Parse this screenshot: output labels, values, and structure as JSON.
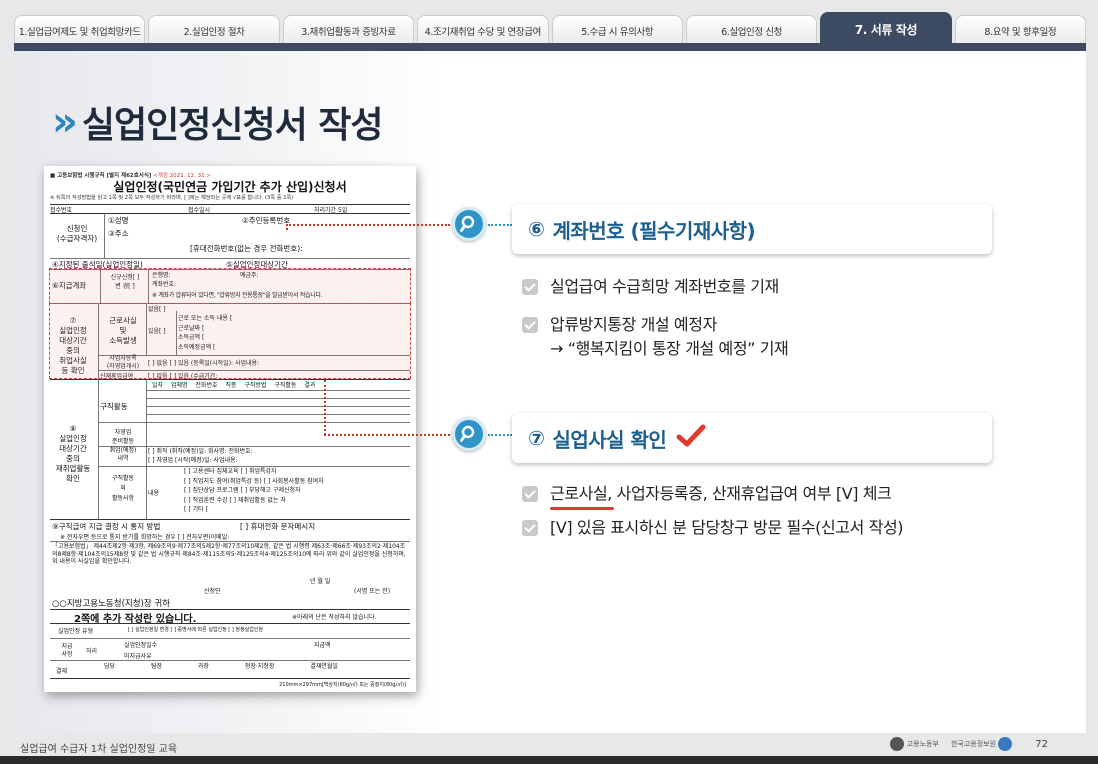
{
  "tabs": [
    {
      "label": "1.실업급여제도 및 취업희망카드",
      "active": false
    },
    {
      "label": "2.실업인정 절차",
      "active": false
    },
    {
      "label": "3.재취업활동과 증빙자료",
      "active": false
    },
    {
      "label": "4.조기재취업 수당 및 연장급여",
      "active": false
    },
    {
      "label": "5.수급 시 유의사항",
      "active": false
    },
    {
      "label": "6.실업인정 신청",
      "active": false
    },
    {
      "label": "7. 서류 작성",
      "active": true
    },
    {
      "label": "8.요약 및 향후일정",
      "active": false
    }
  ],
  "title": {
    "chevron": "»",
    "text": "실업인정신청서 작성"
  },
  "form": {
    "header_line": "■ 고용보험법 시행규칙 [별지 제62호서식]",
    "header_date": "<개정 2021. 12. 31.>",
    "title": "실업인정(국민연금 가입기간 추가 산입)신청서",
    "note": "※ 뒤쪽의 작성방법을 읽고 1쪽 및 2쪽 모두 작성하기 바라며, [ ]에는 해당되는 곳에 √표를 합니다.",
    "page_mark": "(3쪽 중 1쪽)",
    "rows": {
      "receipt_no": "접수번호",
      "receipt_date": "접수일시",
      "period": "처리기간  5일",
      "applicant": "신청인\n(수급자격자)",
      "name": "①성명",
      "rrn": "②주민등록번호",
      "address": "③주소",
      "phone": "[휴대전화번호(없는 경우 전화번호):",
      "designated_date": "④지정된 출석일(실업인정일)",
      "period_target": "⑤실업인정대상기간",
      "payment_account": "⑥지급계좌",
      "account_opts": "신규신청[ ]\n변   경[ ]",
      "bank": "은행명:",
      "holder": "예금주:",
      "account_no": "계좌번호:",
      "account_note": "※ 계좌가 압류되어 있다면, \"압류방지 전용통장\"을 발급받아서 적습니다.",
      "section7": "⑦\n실업인정\n대상기간\n중의\n취업사실\n등 확인",
      "work_fact": "근로사실\n및\n소득발생",
      "none": "없음[ ]",
      "yes": "있음[ ]",
      "work_items": "근로 또는 소득 내용 [\n근로날짜 [\n소득금액 [\n소득예정금액 [",
      "biz_reg": "사업자등록\n(자영업개시)",
      "biz_opts": "[ ] 없음   [ ] 있음 (등록일(시작일):        사업내용:",
      "industrial": "산재휴업급여",
      "industrial_opts": "[ ] 없음   [ ] 있음 (수급기간:",
      "section8": "⑧\n실업인정\n대상기간\n중의\n재취업활동\n확인",
      "job_search": "구직활동",
      "job_cols": "일자   업체명   전화번호   직종   구직방법   구직활동 결과",
      "self_emp": "자영업\n준비활동",
      "employed": "취업(예정)\n내역",
      "employed_opts": "[ ] 취직 (취직(예정)일:      회사명:         전화번호:\n[ ] 자영업 [시작(예정)일:          사업내용:",
      "other_activities": "구직활동\n외\n활동사항",
      "content": "내용",
      "activity_opts": "[ ] 고용센터 집체교육   [ ] 취업특강자\n[ ] 직업지도 참여(취업특강 등)  [ ] 사회봉사활동 참여자\n[ ] 집단상담 프로그램   [ ] 부당해고 구제신청자\n[ ] 직업훈련 수강        [ ] 재취업활동 없는 자\n[ ] 기타 [",
      "notify_method": "⑨구직급여 지급 결정 시 통지 방법",
      "notify_opts": "[ ] 휴대전화 문자메시지",
      "mail_note": "※ 전자우편 등으로 통지 받기를 희망하는 경우  [ ] 전자우편(이메일:",
      "law_text": "「고용보험법」 제44조제2항·제3항, 제69조의9·제77조의5제2항·제77조의10제2항, 같은 법 시행령 제63조·제66조·제93조의2·제104조의8제8항·제104조의15제8항 및 같은 법 시행규칙 제84조·제115조의5·제125조의4·제125조의10에 따라 위와 같이 실업인정을 신청하며, 위 내용이 사실임을 확인합니다.",
      "date_line": "년        월        일",
      "signer": "신청인",
      "sign_note": "(서명 또는 인)",
      "office": "○○지방고용노동청(지청)장   귀하",
      "page2": "2쪽에 추가 작성란 있습니다.",
      "below_note": "※아래의 난은 작성하지 않습니다.",
      "type_label": "실업인정 유형",
      "type_opts": "[ ] 실업인정일 변경   [ ] 증명서에 따른 실업인정   [ ] 정정실업인정",
      "pay_label": "지급\n사항",
      "process": "처리",
      "recog_days": "실업인정일수",
      "pay_days": "지급액",
      "unpaid": "미지급사유",
      "approve": "결재",
      "sign_cols": "담당   팀장   과장   청장·지청장   결재연월일",
      "paper": "210mm×297mm[백상지(80g/㎡) 또는 중질지(80g/㎡)]"
    }
  },
  "callouts": [
    {
      "num": "⑥",
      "title": "계좌번호 (필수기재사항)",
      "bullets": [
        "실업급여 수급희망 계좌번호를 기재",
        "압류방지통장 개설 예정자\n→ “행복지킴이 통장 개설 예정” 기재"
      ]
    },
    {
      "num": "⑦",
      "title": "실업사실 확인",
      "bullets": [
        "근로사실, 사업자등록증, 산재휴업급여 여부 [V] 체크",
        "[V] 있음 표시하신 분 담당창구 방문 필수(신고서 작성)"
      ]
    }
  ],
  "icons": {
    "search": "magnifier-icon",
    "check": "checkmark-icon",
    "bullet": "checkbox-icon"
  },
  "colors": {
    "accent": "#2f95c8",
    "tab_active": "#3c4a62",
    "highlight": "#d6433a",
    "check": "#e0392e"
  },
  "footer": {
    "left": "실업급여 수급자 1차 실업인정일 교육",
    "logo1": "고용노동부",
    "logo2": "한국고용정보원",
    "page": "72"
  }
}
